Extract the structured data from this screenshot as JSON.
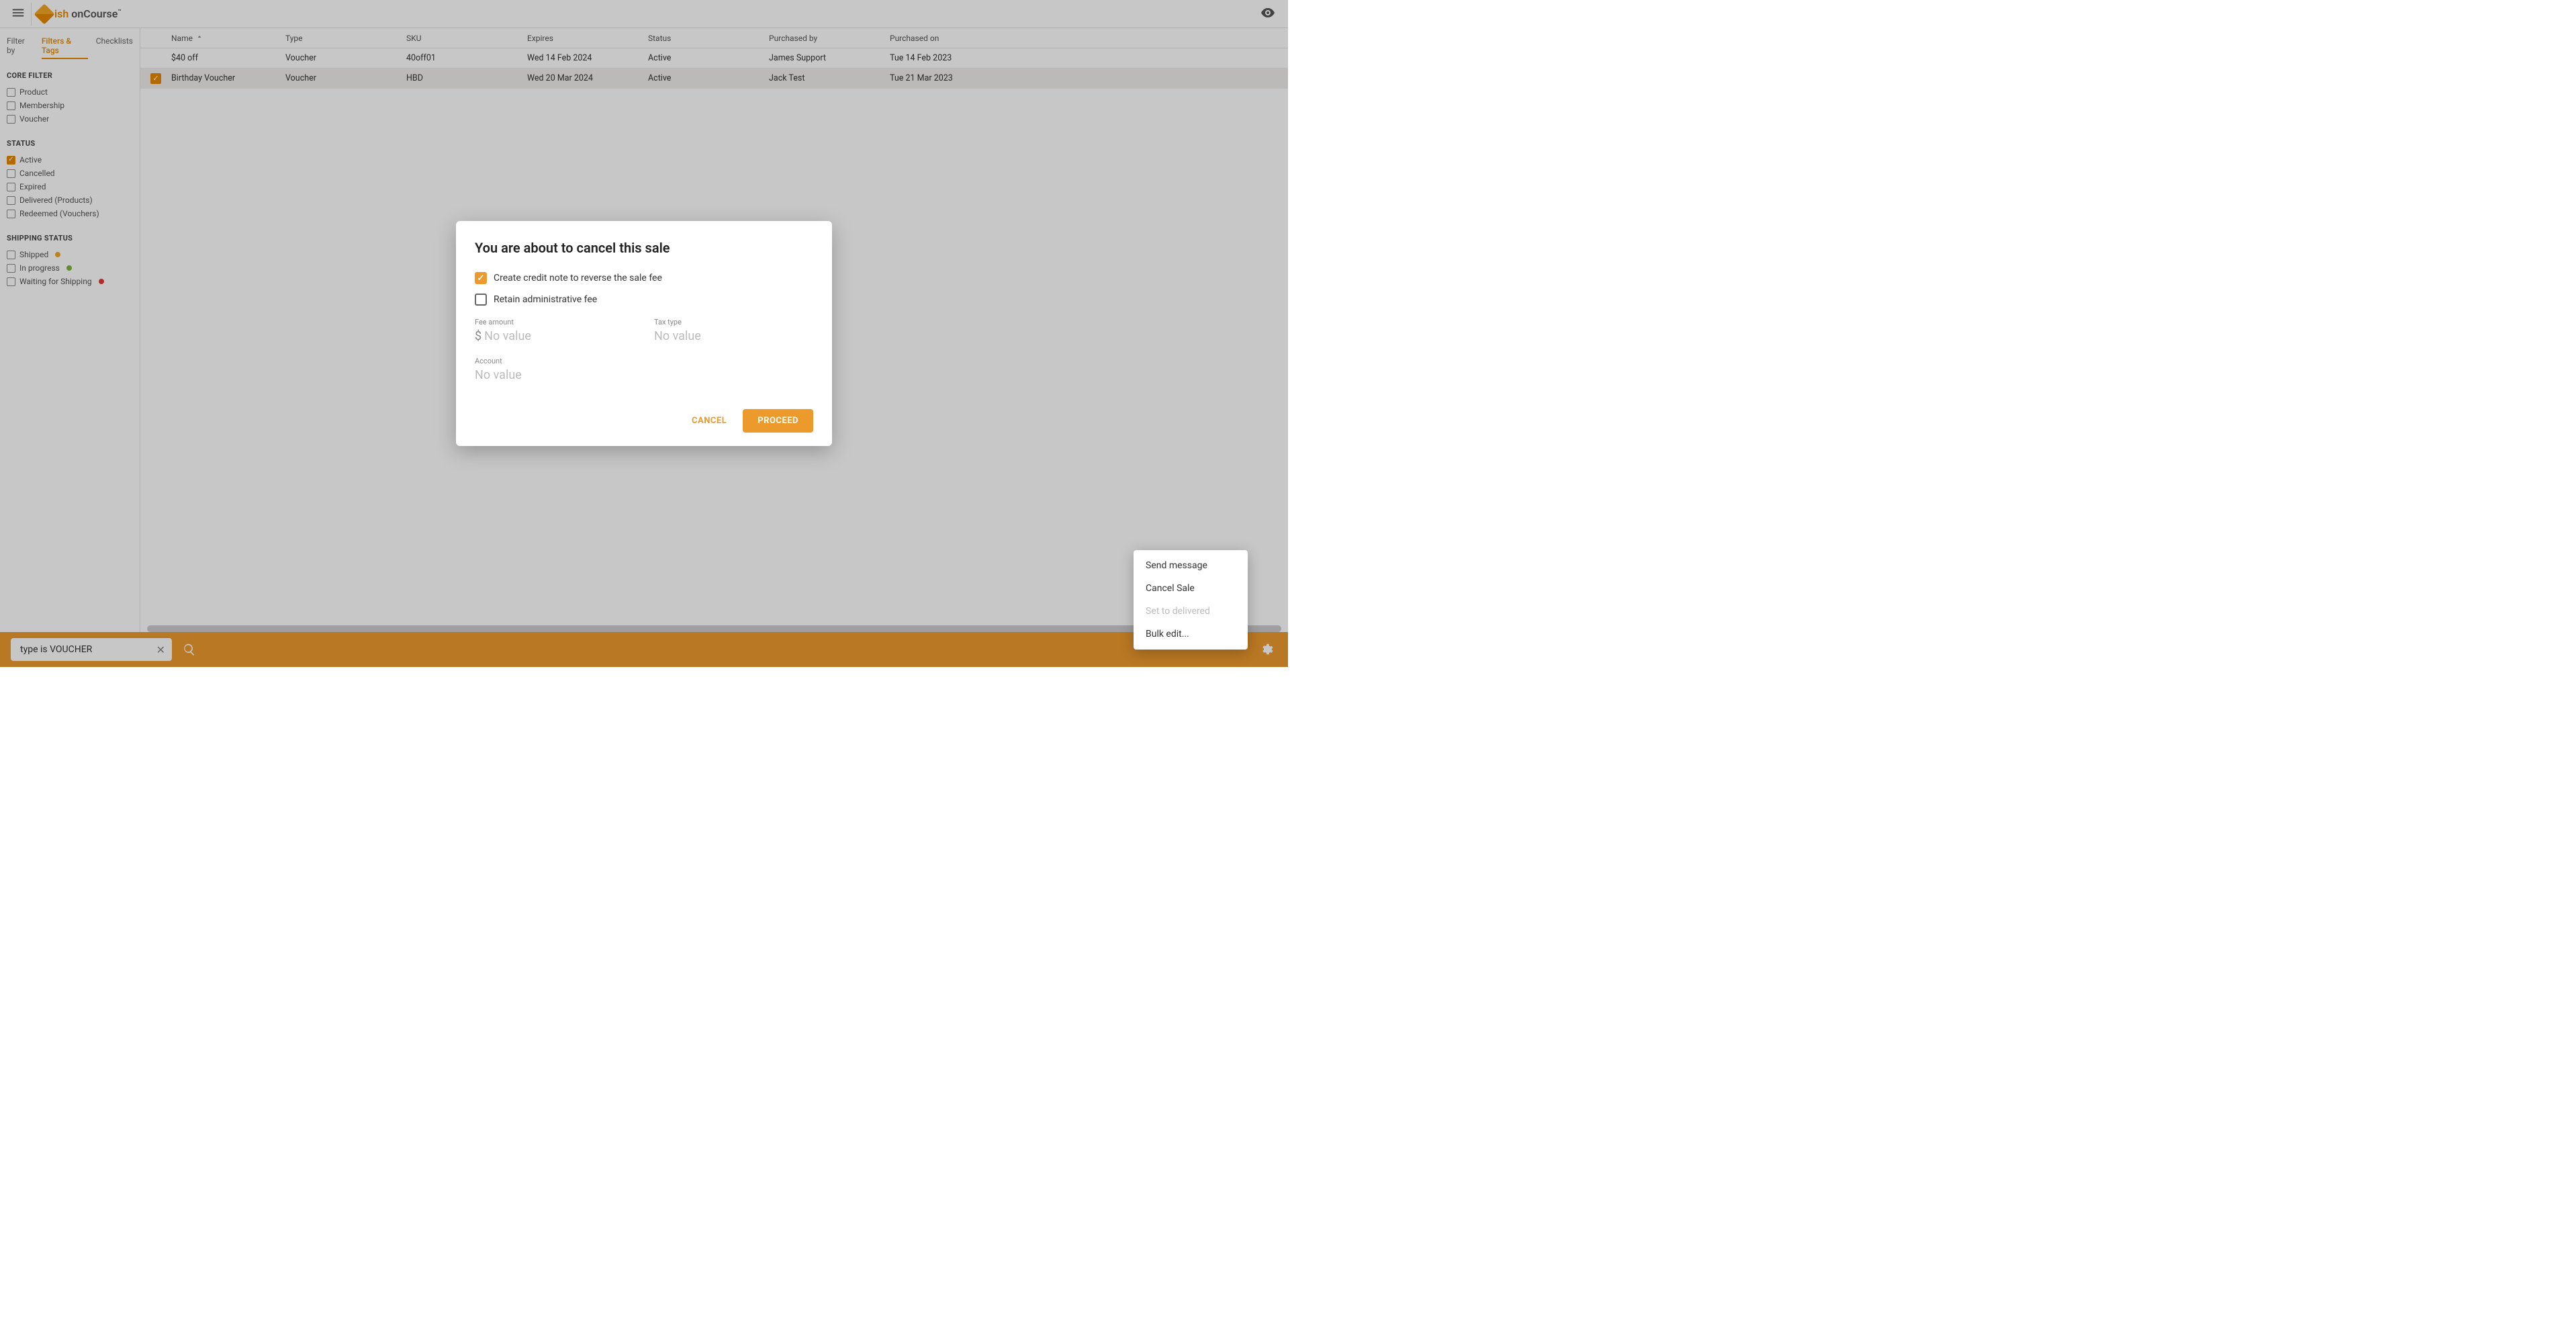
{
  "topbar": {
    "logo_text_prefix": "ish",
    "logo_text_main": "onCourse"
  },
  "sidebar": {
    "tabs": {
      "filter_by": "Filter by",
      "filters_tags": "Filters & Tags",
      "checklists": "Checklists"
    },
    "core_filter": {
      "title": "CORE FILTER",
      "items": [
        {
          "label": "Product",
          "checked": false
        },
        {
          "label": "Membership",
          "checked": false
        },
        {
          "label": "Voucher",
          "checked": false
        }
      ]
    },
    "status": {
      "title": "STATUS",
      "items": [
        {
          "label": "Active",
          "checked": true
        },
        {
          "label": "Cancelled",
          "checked": false
        },
        {
          "label": "Expired",
          "checked": false
        },
        {
          "label": "Delivered (Products)",
          "checked": false
        },
        {
          "label": "Redeemed (Vouchers)",
          "checked": false
        }
      ]
    },
    "shipping": {
      "title": "SHIPPING STATUS",
      "items": [
        {
          "label": "Shipped",
          "dot": "orange"
        },
        {
          "label": "In progress",
          "dot": "green"
        },
        {
          "label": "Waiting for Shipping",
          "dot": "red"
        }
      ]
    }
  },
  "table": {
    "columns": [
      "Name",
      "Type",
      "SKU",
      "Expires",
      "Status",
      "Purchased by",
      "Purchased on"
    ],
    "rows": [
      {
        "selected": false,
        "name": "$40 off",
        "type": "Voucher",
        "sku": "40off01",
        "expires": "Wed 14 Feb 2024",
        "status": "Active",
        "purchased_by": "James Support",
        "purchased_on": "Tue 14 Feb 2023"
      },
      {
        "selected": true,
        "name": "Birthday Voucher",
        "type": "Voucher",
        "sku": "HBD",
        "expires": "Wed 20 Mar 2024",
        "status": "Active",
        "purchased_by": "Jack Test",
        "purchased_on": "Tue 21 Mar 2023"
      }
    ]
  },
  "bottombar": {
    "chip_text": "type is VOUCHER"
  },
  "dialog": {
    "title": "You are about to cancel this sale",
    "check_credit_note": "Create credit note to reverse the sale fee",
    "check_admin_fee": "Retain administrative fee",
    "fee_amount_label": "Fee amount",
    "fee_amount_value": "No value",
    "fee_currency": "$",
    "tax_type_label": "Tax type",
    "tax_type_value": "No value",
    "account_label": "Account",
    "account_value": "No value",
    "cancel_label": "CANCEL",
    "proceed_label": "PROCEED"
  },
  "context_menu": {
    "items": [
      {
        "label": "Send message",
        "disabled": false
      },
      {
        "label": "Cancel Sale",
        "disabled": false
      },
      {
        "label": "Set to delivered",
        "disabled": true
      },
      {
        "label": "Bulk edit...",
        "disabled": false
      }
    ]
  }
}
